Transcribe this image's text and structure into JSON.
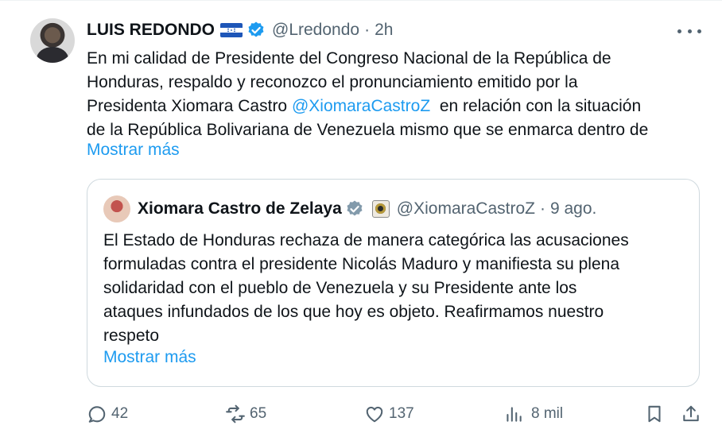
{
  "author": {
    "name": "LUIS REDONDO",
    "handle": "@Lredondo",
    "separator": "·",
    "time": "2h",
    "icons": [
      "honduras-flag-icon",
      "verified-badge-icon"
    ]
  },
  "post": {
    "lines": [
      "En mi calidad de Presidente del Congreso Nacional de la República de",
      "Honduras, respaldo y reconozco el pronunciamiento emitido por la",
      "de la República Bolivariana de Venezuela mismo que se enmarca dentro de"
    ],
    "line3_prefix": "Presidenta Xiomara Castro ",
    "line3_mention": "@XiomaraCastroZ",
    "line3_suffix": "  en relación con la situación",
    "show_more": "Mostrar más"
  },
  "quote": {
    "name": "Xiomara Castro de Zelaya",
    "handle": "@XiomaraCastroZ",
    "separator": "·",
    "time": "9 ago.",
    "lines": [
      "El Estado de Honduras rechaza de manera categórica las acusaciones",
      "formuladas contra el presidente Nicolás Maduro y manifiesta su plena",
      "solidaridad con el pueblo de Venezuela y su Presidente ante los",
      "ataques infundados de los que hoy es objeto. Reafirmamos nuestro",
      "respeto"
    ],
    "show_more": "Mostrar más",
    "icons": [
      "verified-badge-gray-icon",
      "government-seal-icon"
    ]
  },
  "actions": {
    "replies": "42",
    "reposts": "65",
    "likes": "137",
    "views": "8 mil"
  },
  "colors": {
    "accent": "#1d9bf0",
    "text": "#0f1419",
    "secondary": "#536471",
    "border": "#cfd9de",
    "verified_blue": "#1d9bf0",
    "verified_gray": "#829aab"
  }
}
